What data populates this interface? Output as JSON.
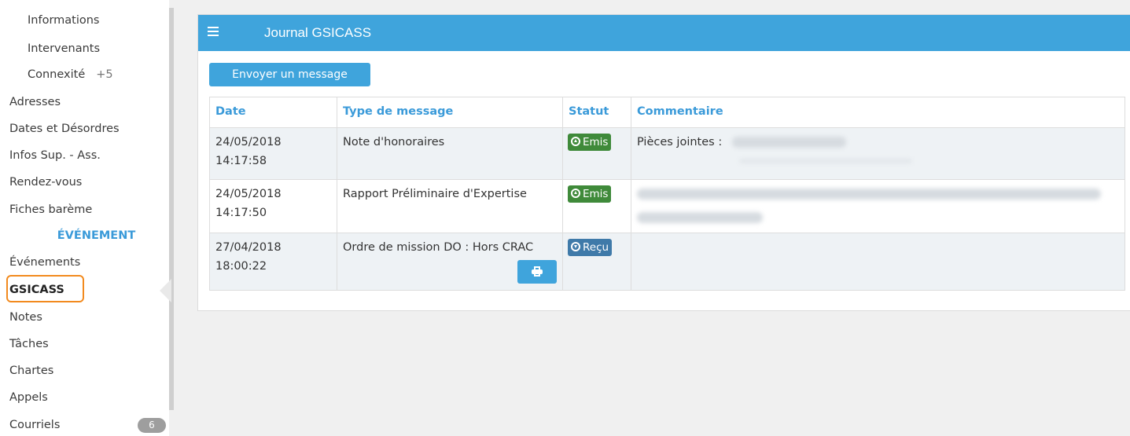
{
  "sidebar": {
    "items": [
      {
        "label": "Informations"
      },
      {
        "label": "Intervenants"
      },
      {
        "label": "Connexité",
        "extra": "+5"
      },
      {
        "label": "Adresses"
      },
      {
        "label": "Dates et Désordres"
      },
      {
        "label": "Infos Sup. - Ass."
      },
      {
        "label": "Rendez-vous"
      },
      {
        "label": "Fiches barème"
      },
      {
        "label": "Événements"
      },
      {
        "label": "GSICASS"
      },
      {
        "label": "Notes"
      },
      {
        "label": "Tâches"
      },
      {
        "label": "Chartes"
      },
      {
        "label": "Appels"
      },
      {
        "label": "Courriels",
        "badge": "6"
      }
    ],
    "section_label": "ÉVÉNEMENT"
  },
  "panel": {
    "title": "Journal GSICASS",
    "send_button": "Envoyer un message"
  },
  "table": {
    "headers": [
      "Date",
      "Type de message",
      "Statut",
      "Commentaire"
    ],
    "rows": [
      {
        "date": "24/05/2018",
        "time": "14:17:58",
        "type": "Note d'honoraires",
        "status": "Emis",
        "comment": "Pièces jointes :"
      },
      {
        "date": "24/05/2018",
        "time": "14:17:50",
        "type": "Rapport Préliminaire d'Expertise",
        "status": "Emis",
        "comment": ""
      },
      {
        "date": "27/04/2018",
        "time": "18:00:22",
        "type": "Ordre de mission DO : Hors CRAC",
        "status": "Reçu",
        "comment": ""
      }
    ]
  },
  "colors": {
    "accent": "#3fa4dc",
    "sent": "#3f8a3a",
    "received": "#3f7aa9",
    "highlight": "#f28a1e"
  }
}
